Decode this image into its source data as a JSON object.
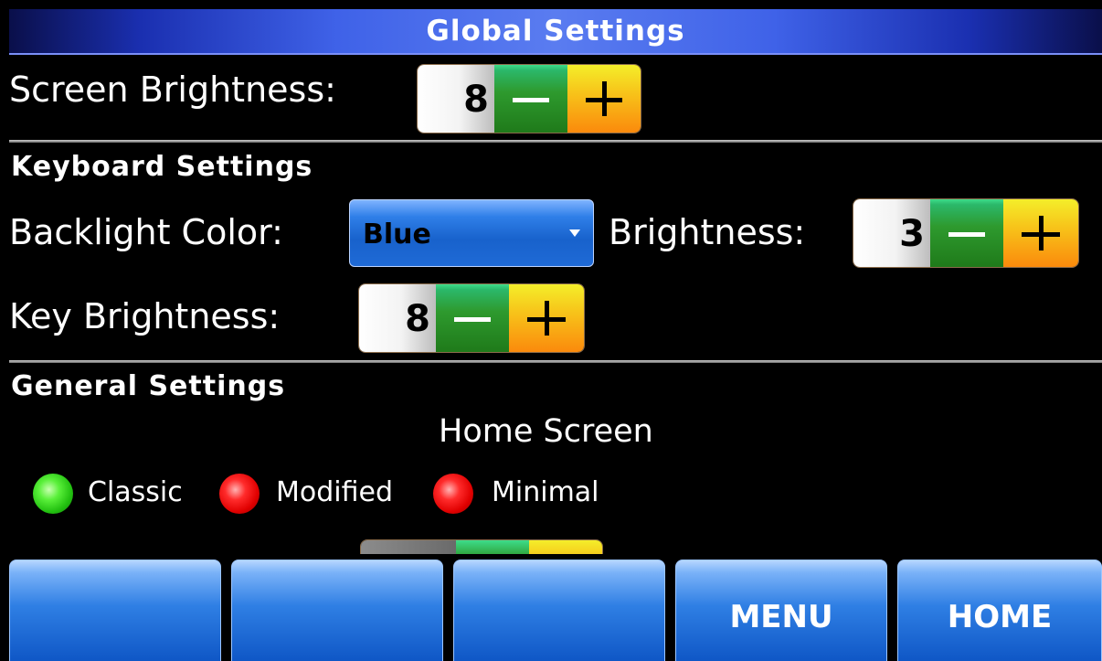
{
  "title": "Global Settings",
  "screen": {
    "brightness_label": "Screen Brightness:",
    "brightness_value": "8"
  },
  "keyboard": {
    "heading": "Keyboard Settings",
    "backlight_label": "Backlight Color:",
    "backlight_value": "Blue",
    "brightness_label": "Brightness:",
    "brightness_value": "3",
    "key_brightness_label": "Key Brightness:",
    "key_brightness_value": "8"
  },
  "general": {
    "heading": "General Settings",
    "home_screen_label": "Home Screen",
    "options": [
      {
        "label": "Classic",
        "selected": true,
        "color": "#22c010"
      },
      {
        "label": "Modified",
        "selected": false,
        "color": "#e00000"
      },
      {
        "label": "Minimal",
        "selected": false,
        "color": "#e00000"
      }
    ]
  },
  "bottom_bar": {
    "buttons": [
      "",
      "",
      "",
      "MENU",
      "HOME"
    ]
  }
}
